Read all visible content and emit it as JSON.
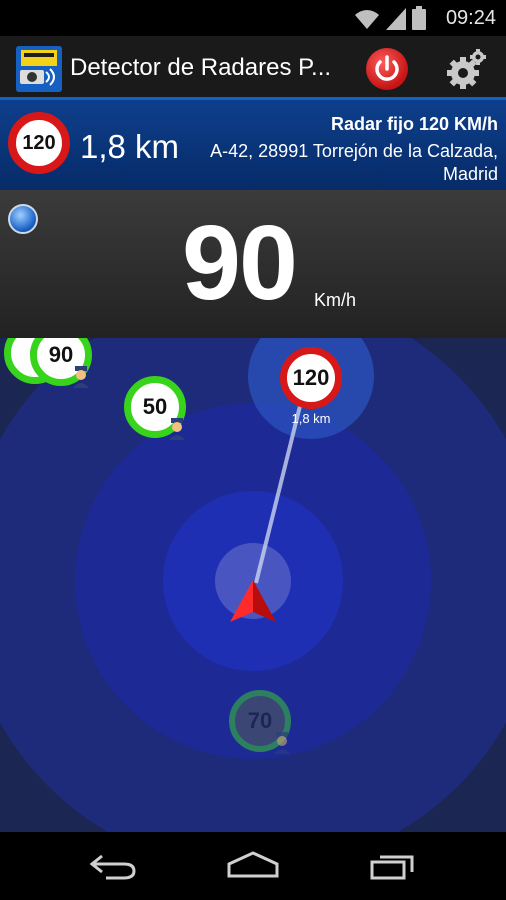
{
  "status_bar": {
    "time": "09:24"
  },
  "app": {
    "title": "Detector de Radares P..."
  },
  "banner": {
    "sign_speed": "120",
    "distance": "1,8 km",
    "radar_type": "Radar fijo 120 KM/h",
    "address": "A-42, 28991 Torrejón de la Calzada, Madrid"
  },
  "speed": {
    "value": "90",
    "unit": "Km/h"
  },
  "map": {
    "radars": [
      {
        "speed": "6",
        "type": "mobile"
      },
      {
        "speed": "90",
        "type": "mobile"
      },
      {
        "speed": "50",
        "type": "mobile"
      },
      {
        "speed": "120",
        "type": "fixed",
        "distance": "1,8 km"
      },
      {
        "speed": "70",
        "type": "mobile"
      }
    ]
  },
  "colors": {
    "accent": "#0c64c8",
    "banner": "#0e3f8c",
    "sign_red": "#d81818",
    "mobile_green": "#38d41c",
    "map_background": "#1b2652"
  },
  "icons": {
    "app": "radar-camera-icon",
    "power": "power-icon",
    "settings": "gear-icon",
    "gps": "gps-status-icon",
    "position": "navigation-arrow-icon",
    "back": "back-icon",
    "home": "home-icon",
    "recents": "recents-icon"
  }
}
